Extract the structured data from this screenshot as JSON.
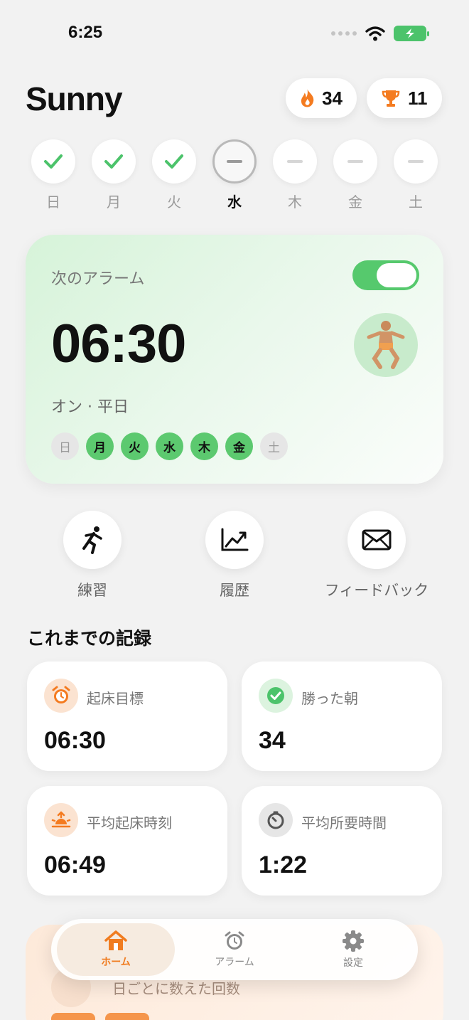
{
  "status": {
    "time": "6:25"
  },
  "header": {
    "title": "Sunny",
    "streak": "34",
    "trophies": "11"
  },
  "week": [
    {
      "label": "日",
      "state": "done"
    },
    {
      "label": "月",
      "state": "done"
    },
    {
      "label": "火",
      "state": "done"
    },
    {
      "label": "水",
      "state": "today"
    },
    {
      "label": "木",
      "state": "pending"
    },
    {
      "label": "金",
      "state": "pending"
    },
    {
      "label": "土",
      "state": "pending"
    }
  ],
  "alarm": {
    "label": "次のアラーム",
    "time": "06:30",
    "subtitle": "オン · 平日",
    "enabled": true,
    "days": [
      {
        "label": "日",
        "on": false
      },
      {
        "label": "月",
        "on": true
      },
      {
        "label": "火",
        "on": true
      },
      {
        "label": "水",
        "on": true
      },
      {
        "label": "木",
        "on": true
      },
      {
        "label": "金",
        "on": true
      },
      {
        "label": "土",
        "on": false
      }
    ]
  },
  "actions": {
    "practice": "練習",
    "history": "履歴",
    "feedback": "フィードバック"
  },
  "records": {
    "title": "これまでの記録",
    "target_label": "起床目標",
    "target_value": "06:30",
    "wins_label": "勝った朝",
    "wins_value": "34",
    "avg_wake_label": "平均起床時刻",
    "avg_wake_value": "06:49",
    "avg_duration_label": "平均所要時間",
    "avg_duration_value": "1:22"
  },
  "peek": {
    "text": "日ごとに数えた回数"
  },
  "tabs": {
    "home": "ホーム",
    "alarm": "アラーム",
    "settings": "設定"
  },
  "colors": {
    "accent_green": "#56c96d",
    "accent_orange": "#f07c20"
  }
}
